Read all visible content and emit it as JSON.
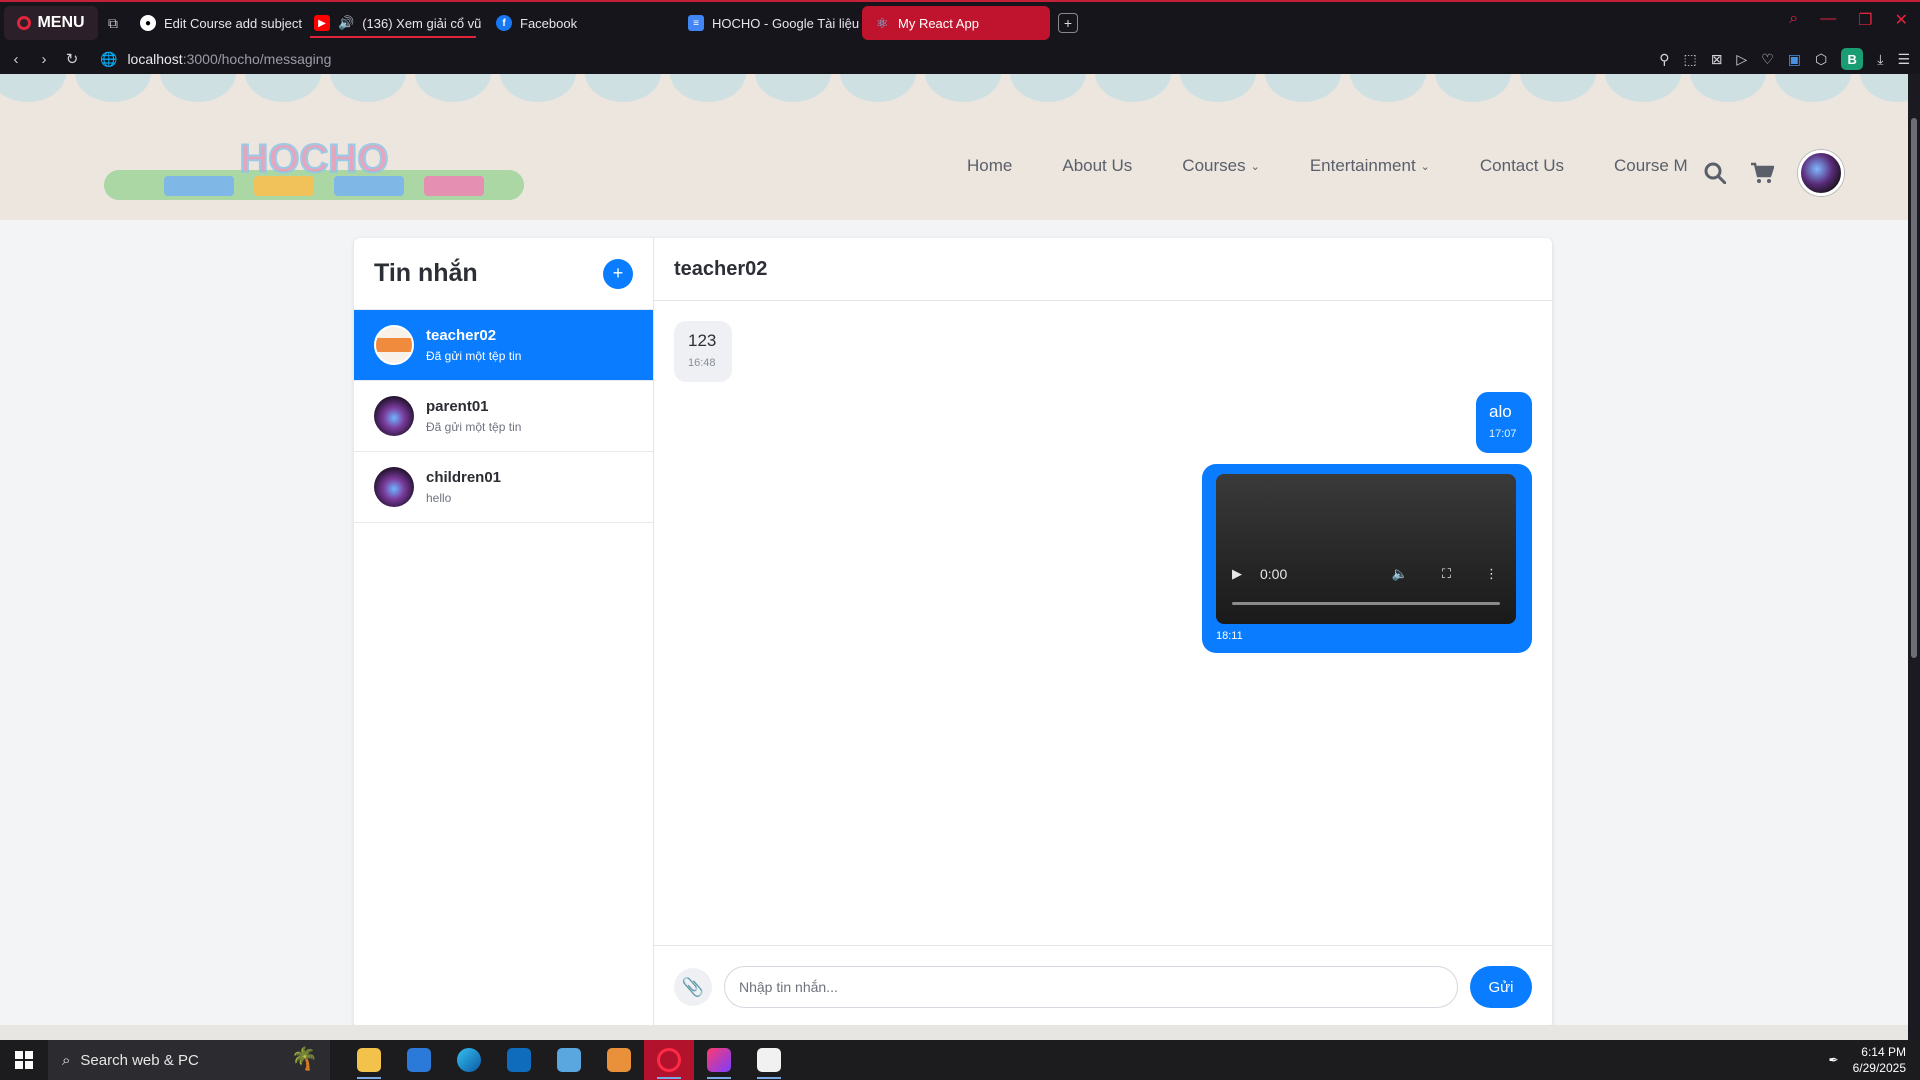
{
  "browser": {
    "menu_label": "MENU",
    "tabs": [
      {
        "title": "Edit Course add subject ,"
      },
      {
        "title": "(136) Xem giải cổ vũ a"
      },
      {
        "title": "Facebook"
      },
      {
        "title": "HOCHO - Google Tài liệu"
      },
      {
        "title": "My React App"
      }
    ],
    "url_host": "localhost",
    "url_path": ":3000/hocho/messaging",
    "profile_badge": "B"
  },
  "site": {
    "logo_text": "HOCHO",
    "nav": [
      {
        "label": "Home"
      },
      {
        "label": "About Us"
      },
      {
        "label": "Courses"
      },
      {
        "label": "Entertainment"
      },
      {
        "label": "Contact Us"
      },
      {
        "label": "Course M"
      }
    ]
  },
  "messaging": {
    "title": "Tin nhắn",
    "conversations": [
      {
        "name": "teacher02",
        "preview": "Đã gửi một tệp tin"
      },
      {
        "name": "parent01",
        "preview": "Đã gửi một tệp tin"
      },
      {
        "name": "children01",
        "preview": "hello"
      }
    ],
    "active_chat": "teacher02",
    "messages": [
      {
        "text": "123",
        "time": "16:48",
        "direction": "incoming"
      },
      {
        "text": "alo",
        "time": "17:07",
        "direction": "outgoing"
      },
      {
        "type": "video",
        "video_time": "0:00",
        "time": "18:11",
        "direction": "outgoing"
      }
    ],
    "input_placeholder": "Nhập tin nhắn...",
    "send_label": "Gửi"
  },
  "taskbar": {
    "search_text": "Search web & PC",
    "time": "6:14 PM",
    "date": "6/29/2025"
  },
  "colors": {
    "accent": "#0a7cff",
    "browser_accent": "#c0142e",
    "header_bg": "#ece6df"
  }
}
